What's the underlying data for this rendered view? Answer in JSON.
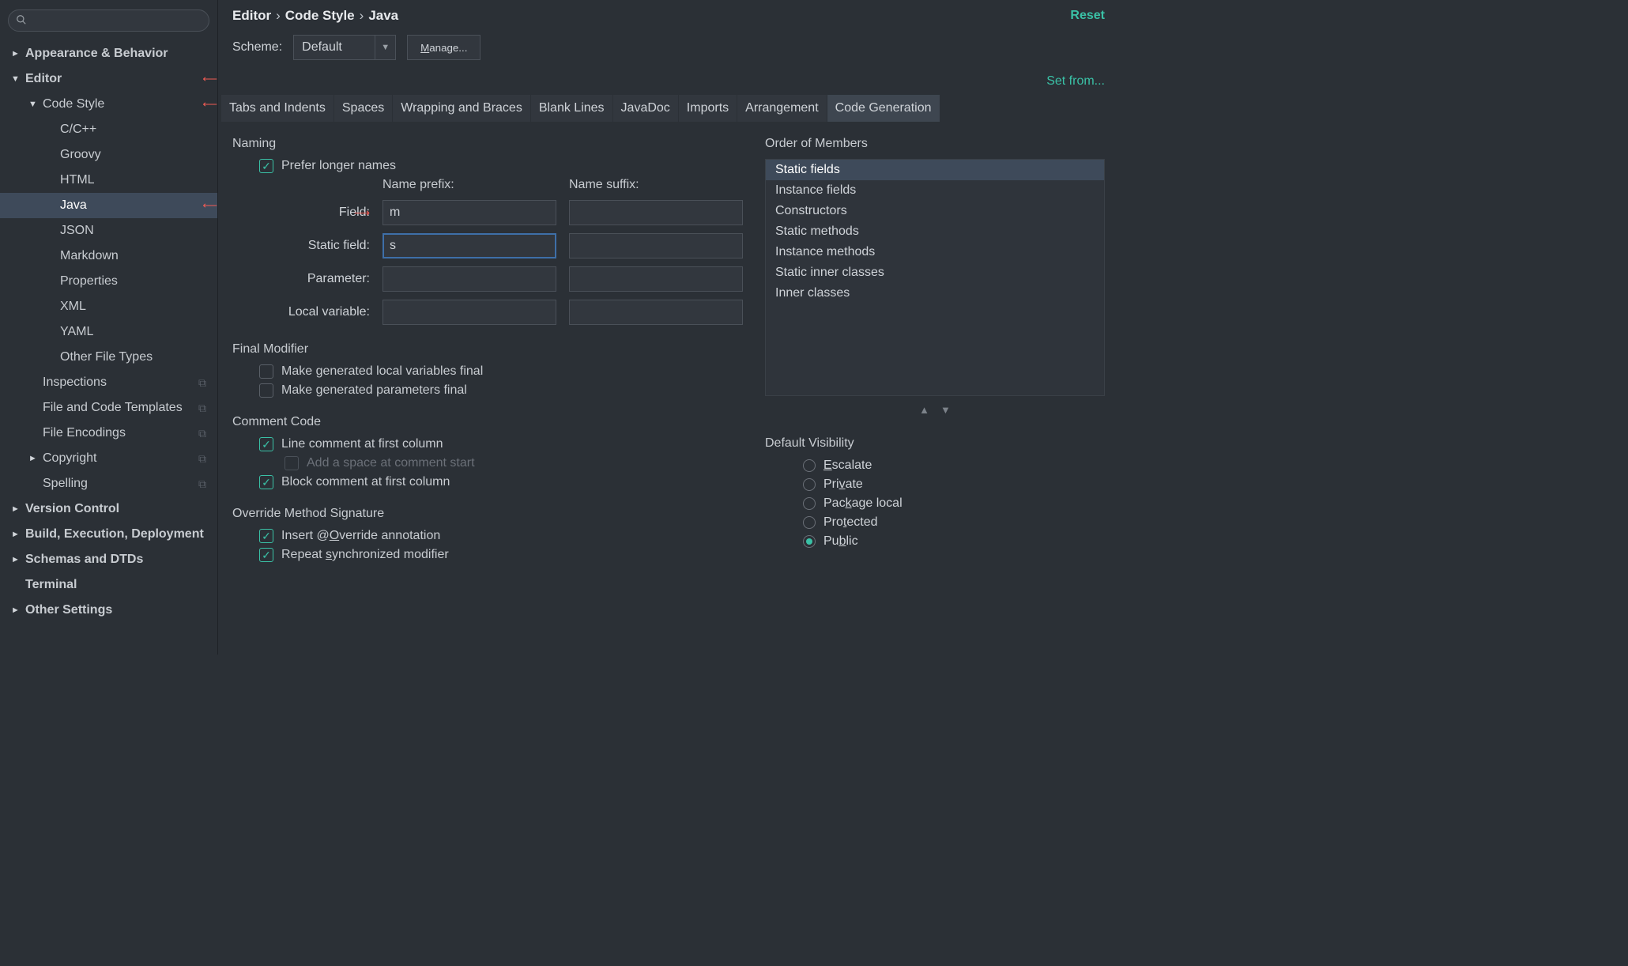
{
  "search": {
    "placeholder": ""
  },
  "tree": [
    {
      "label": "Appearance & Behavior",
      "arrow": "►",
      "bold": true,
      "indent": 0
    },
    {
      "label": "Editor",
      "arrow": "▼",
      "bold": true,
      "indent": 0,
      "red": true
    },
    {
      "label": "Code Style",
      "arrow": "▼",
      "bold": false,
      "indent": 1,
      "red": true
    },
    {
      "label": "C/C++",
      "arrow": "",
      "indent": 2
    },
    {
      "label": "Groovy",
      "arrow": "",
      "indent": 2
    },
    {
      "label": "HTML",
      "arrow": "",
      "indent": 2
    },
    {
      "label": "Java",
      "arrow": "",
      "indent": 2,
      "selected": true,
      "red": true
    },
    {
      "label": "JSON",
      "arrow": "",
      "indent": 2
    },
    {
      "label": "Markdown",
      "arrow": "",
      "indent": 2
    },
    {
      "label": "Properties",
      "arrow": "",
      "indent": 2
    },
    {
      "label": "XML",
      "arrow": "",
      "indent": 2
    },
    {
      "label": "YAML",
      "arrow": "",
      "indent": 2
    },
    {
      "label": "Other File Types",
      "arrow": "",
      "indent": 2
    },
    {
      "label": "Inspections",
      "arrow": "",
      "indent": 1,
      "dup": true
    },
    {
      "label": "File and Code Templates",
      "arrow": "",
      "indent": 1,
      "dup": true
    },
    {
      "label": "File Encodings",
      "arrow": "",
      "indent": 1,
      "dup": true
    },
    {
      "label": "Copyright",
      "arrow": "►",
      "indent": 1,
      "dup": true
    },
    {
      "label": "Spelling",
      "arrow": "",
      "indent": 1,
      "dup": true
    },
    {
      "label": "Version Control",
      "arrow": "►",
      "bold": true,
      "indent": 0
    },
    {
      "label": "Build, Execution, Deployment",
      "arrow": "►",
      "bold": true,
      "indent": 0
    },
    {
      "label": "Schemas and DTDs",
      "arrow": "►",
      "bold": true,
      "indent": 0
    },
    {
      "label": "Terminal",
      "arrow": "",
      "bold": true,
      "indent": 0
    },
    {
      "label": "Other Settings",
      "arrow": "►",
      "bold": true,
      "indent": 0
    }
  ],
  "breadcrumb": {
    "a": "Editor",
    "b": "Code Style",
    "c": "Java"
  },
  "links": {
    "reset": "Reset",
    "setfrom": "Set from..."
  },
  "scheme": {
    "label": "Scheme:",
    "value": "Default",
    "manage": "Manage..."
  },
  "tabs": [
    "Tabs and Indents",
    "Spaces",
    "Wrapping and Braces",
    "Blank Lines",
    "JavaDoc",
    "Imports",
    "Arrangement",
    "Code Generation"
  ],
  "activeTab": 7,
  "naming": {
    "title": "Naming",
    "prefer": "Prefer longer names",
    "prefix_hdr": "Name prefix:",
    "suffix_hdr": "Name suffix:",
    "rows": [
      {
        "label": "Field:",
        "prefix": "m",
        "suffix": ""
      },
      {
        "label": "Static field:",
        "prefix": "s",
        "suffix": "",
        "focus": true
      },
      {
        "label": "Parameter:",
        "prefix": "",
        "suffix": ""
      },
      {
        "label": "Local variable:",
        "prefix": "",
        "suffix": ""
      }
    ]
  },
  "finalmod": {
    "title": "Final Modifier",
    "items": [
      "Make generated local variables final",
      "Make generated parameters final"
    ]
  },
  "comment": {
    "title": "Comment Code",
    "line": "Line comment at first column",
    "space": "Add a space at comment start",
    "block": "Block comment at first column"
  },
  "override": {
    "title": "Override Method Signature",
    "insert_pre": "Insert @",
    "insert_u": "O",
    "insert_post": "verride annotation",
    "repeat_pre": "Repeat ",
    "repeat_u": "s",
    "repeat_post": "ynchronized modifier"
  },
  "order": {
    "title": "Order of Members",
    "items": [
      "Static fields",
      "Instance fields",
      "Constructors",
      "Static methods",
      "Instance methods",
      "Static inner classes",
      "Inner classes"
    ],
    "selected": 0
  },
  "vis": {
    "title": "Default Visibility",
    "options": [
      {
        "pre": "",
        "u": "E",
        "post": "scalate"
      },
      {
        "pre": "Pri",
        "u": "v",
        "post": "ate"
      },
      {
        "pre": "Pac",
        "u": "k",
        "post": "age local"
      },
      {
        "pre": "Pro",
        "u": "t",
        "post": "ected"
      },
      {
        "pre": "Pu",
        "u": "b",
        "post": "lic"
      }
    ],
    "selected": 4
  }
}
